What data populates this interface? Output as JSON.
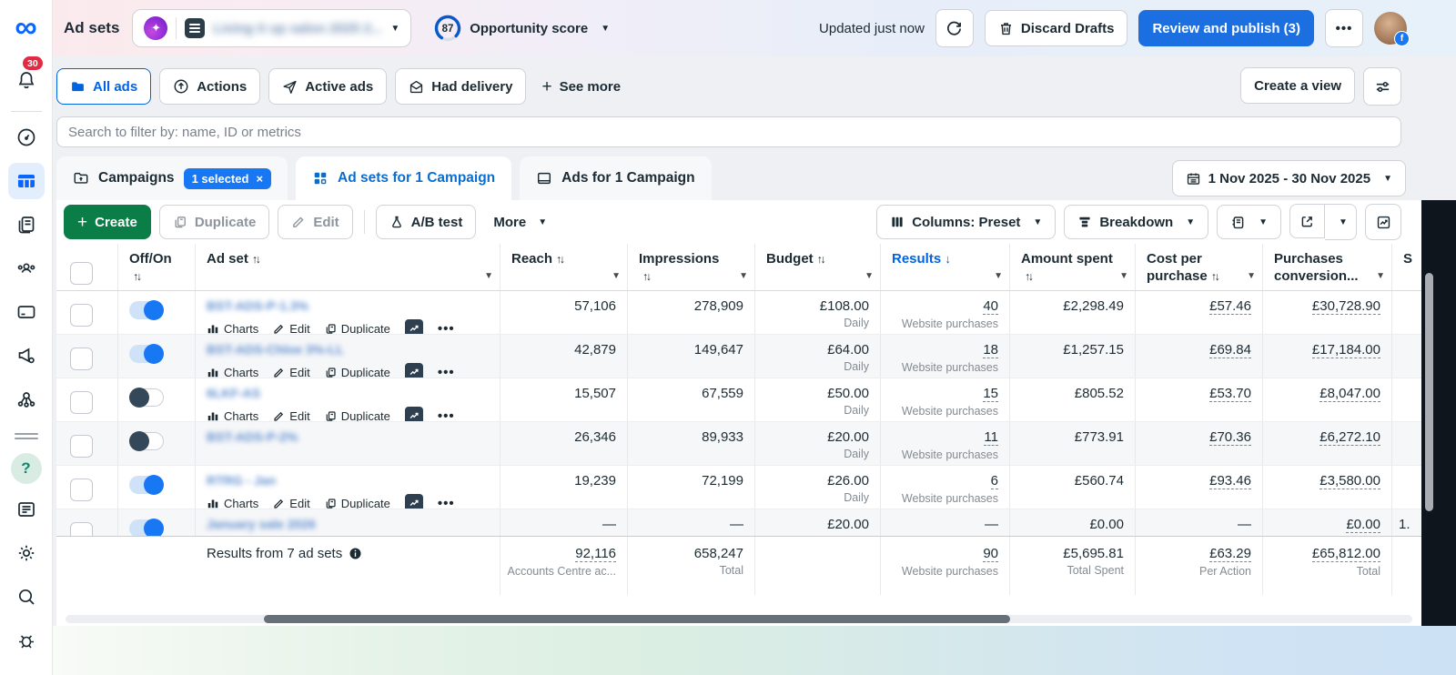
{
  "sidebar": {
    "notif_badge": "30"
  },
  "header": {
    "title": "Ad sets",
    "account_name": "Living it up salon 2025 2...",
    "opportunity_score": "87",
    "opportunity_label": "Opportunity score",
    "updated": "Updated just now",
    "discard_label": "Discard Drafts",
    "review_label": "Review and publish (3)"
  },
  "filters": {
    "all_ads": "All ads",
    "actions": "Actions",
    "active_ads": "Active ads",
    "had_delivery": "Had delivery",
    "see_more": "See more",
    "create_view": "Create a view"
  },
  "search": {
    "placeholder": "Search to filter by: name, ID or metrics"
  },
  "tabs": {
    "campaigns": "Campaigns",
    "campaigns_badge": "1 selected",
    "adsets": "Ad sets for 1 Campaign",
    "ads": "Ads for 1 Campaign",
    "date_range": "1 Nov 2025 - 30 Nov 2025"
  },
  "toolbar": {
    "create": "Create",
    "duplicate": "Duplicate",
    "edit": "Edit",
    "abtest": "A/B test",
    "more": "More",
    "columns": "Columns: Preset",
    "breakdown": "Breakdown"
  },
  "table": {
    "headers": {
      "onoff": "Off/On",
      "adset": "Ad set",
      "reach": "Reach",
      "impressions": "Impressions",
      "budget": "Budget",
      "results": "Results",
      "spent": "Amount spent",
      "cpp_l1": "Cost per",
      "cpp_l2": "purchase",
      "pcv_l1": "Purchases",
      "pcv_l2": "conversion...",
      "extra": "S"
    },
    "row_actions": {
      "charts": "Charts",
      "edit": "Edit",
      "duplicate": "Duplicate"
    },
    "rows": [
      {
        "name": "BST-ADS-P-1.3%",
        "on": true,
        "actions": true,
        "reach": "57,106",
        "impressions": "278,909",
        "budget": "£108.00",
        "budget_sub": "Daily",
        "results": "40",
        "results_sub": "Website purchases",
        "spent": "£2,298.49",
        "cpp": "£57.46",
        "pcv": "£30,728.90",
        "extra": ""
      },
      {
        "name": "BST-ADS-Chloe 3%-LL",
        "on": true,
        "actions": true,
        "reach": "42,879",
        "impressions": "149,647",
        "budget": "£64.00",
        "budget_sub": "Daily",
        "results": "18",
        "results_sub": "Website purchases",
        "spent": "£1,257.15",
        "cpp": "£69.84",
        "pcv": "£17,184.00",
        "extra": ""
      },
      {
        "name": "6LKF-AS",
        "on": false,
        "actions": true,
        "reach": "15,507",
        "impressions": "67,559",
        "budget": "£50.00",
        "budget_sub": "Daily",
        "results": "15",
        "results_sub": "Website purchases",
        "spent": "£805.52",
        "cpp": "£53.70",
        "pcv": "£8,047.00",
        "extra": ""
      },
      {
        "name": "BST-ADS-P-2%",
        "on": false,
        "actions": false,
        "reach": "26,346",
        "impressions": "89,933",
        "budget": "£20.00",
        "budget_sub": "Daily",
        "results": "11",
        "results_sub": "Website purchases",
        "spent": "£773.91",
        "cpp": "£70.36",
        "pcv": "£6,272.10",
        "extra": ""
      },
      {
        "name": "RTRG - Jan",
        "on": true,
        "actions": true,
        "reach": "19,239",
        "impressions": "72,199",
        "budget": "£26.00",
        "budget_sub": "Daily",
        "results": "6",
        "results_sub": "Website purchases",
        "spent": "£560.74",
        "cpp": "£93.46",
        "pcv": "£3,580.00",
        "extra": ""
      },
      {
        "name": "January sale 2026",
        "on": true,
        "actions": false,
        "reach": "—",
        "impressions": "—",
        "budget": "£20.00",
        "budget_sub": "",
        "results": "—",
        "results_sub": "",
        "spent": "£0.00",
        "cpp": "—",
        "pcv": "£0.00",
        "extra": "1.",
        "compact": true
      }
    ],
    "summary": {
      "label": "Results from 7 ad sets",
      "reach": "92,116",
      "reach_sub": "Accounts Centre ac...",
      "impressions": "658,247",
      "impressions_sub": "Total",
      "results": "90",
      "results_sub": "Website purchases",
      "spent": "£5,695.81",
      "spent_sub": "Total Spent",
      "cpp": "£63.29",
      "cpp_sub": "Per Action",
      "pcv": "£65,812.00",
      "pcv_sub": "Total"
    }
  }
}
